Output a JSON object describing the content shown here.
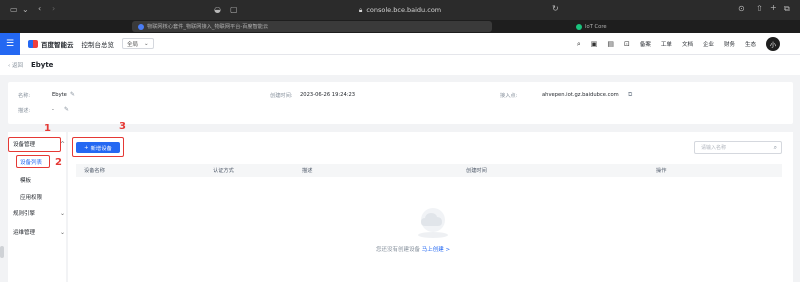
{
  "browser": {
    "url": "console.bce.baidu.com",
    "tabs": [
      {
        "label": "物联网核心套件_物联网接入_物联网平台-百度智能云",
        "active": true
      },
      {
        "label": "IoT Core",
        "active": false
      }
    ]
  },
  "header": {
    "logo_text": "百度智能云",
    "console_label": "控制台总览",
    "region": "全局",
    "menu_items": [
      "备案",
      "工单",
      "文档",
      "企业",
      "财务",
      "生态"
    ],
    "avatar_initial": "小"
  },
  "breadcrumb": {
    "back_label": "返回",
    "title": "Ebyte"
  },
  "info": {
    "name_label": "名称:",
    "name_value": "Ebyte",
    "desc_label": "描述:",
    "desc_value": "-",
    "created_label": "创建时间:",
    "created_value": "2023-06-26 19:24:23",
    "endpoint_label": "接入点:",
    "endpoint_value": "ahvepen.iot.gz.baidubce.com"
  },
  "sidebar": {
    "items": [
      {
        "label": "设备管理",
        "expanded": true
      },
      {
        "label": "设备列表",
        "selected": true
      },
      {
        "label": "模板"
      },
      {
        "label": "应用权限"
      },
      {
        "label": "规则引擎",
        "expanded": false
      },
      {
        "label": "运维管理",
        "expanded": false
      }
    ]
  },
  "main": {
    "add_button": "新增设备",
    "search_placeholder": "请输入名称",
    "columns": [
      "设备名称",
      "认证方式",
      "描述",
      "创建时间",
      "操作"
    ],
    "empty_text": "您还没有创建设备",
    "empty_link": "马上创建 >"
  },
  "annotations": [
    "1",
    "2",
    "3"
  ],
  "colors": {
    "accent": "#2468f2",
    "annotation": "#e53935"
  }
}
